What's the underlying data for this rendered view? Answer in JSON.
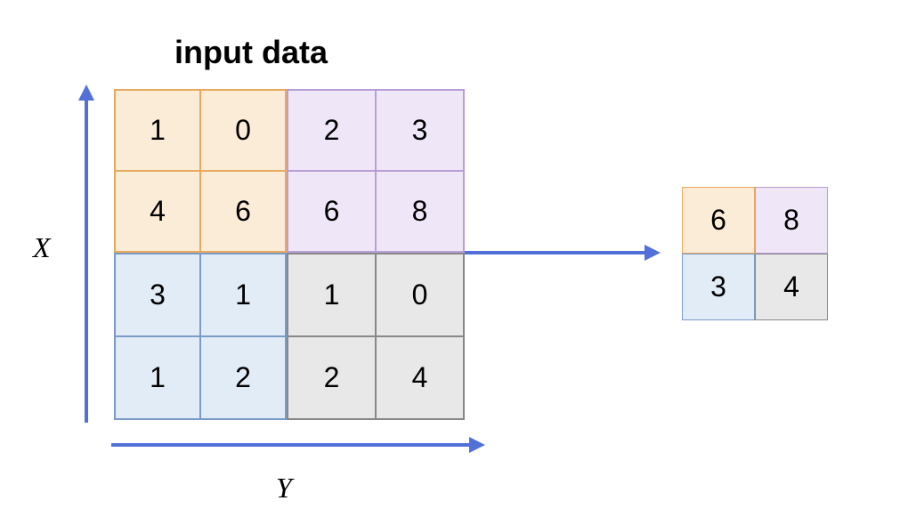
{
  "title": "input data",
  "axis": {
    "x_label": "X",
    "y_label": "Y"
  },
  "chart_data": {
    "type": "table",
    "title": "input data",
    "description": "Max pooling 2x2 applied to 4x4 input matrix producing 2x2 output",
    "input_matrix": [
      [
        1,
        0,
        2,
        3
      ],
      [
        4,
        6,
        6,
        8
      ],
      [
        3,
        1,
        1,
        0
      ],
      [
        1,
        2,
        2,
        4
      ]
    ],
    "output_matrix": [
      [
        6,
        8
      ],
      [
        3,
        4
      ]
    ],
    "quadrants": {
      "top_left": {
        "values": [
          [
            1,
            0
          ],
          [
            4,
            6
          ]
        ],
        "max": 6,
        "color": "#fbecd7"
      },
      "top_right": {
        "values": [
          [
            2,
            3
          ],
          [
            6,
            8
          ]
        ],
        "max": 8,
        "color": "#efe7f8"
      },
      "bottom_left": {
        "values": [
          [
            3,
            1
          ],
          [
            1,
            2
          ]
        ],
        "max": 3,
        "color": "#e2ecf7"
      },
      "bottom_right": {
        "values": [
          [
            1,
            0
          ],
          [
            2,
            4
          ]
        ],
        "max": 4,
        "color": "#e8e8e8"
      }
    }
  },
  "input": {
    "tl": {
      "r0c0": "1",
      "r0c1": "0",
      "r1c0": "4",
      "r1c1": "6"
    },
    "tr": {
      "r0c0": "2",
      "r0c1": "3",
      "r1c0": "6",
      "r1c1": "8"
    },
    "bl": {
      "r0c0": "3",
      "r0c1": "1",
      "r1c0": "1",
      "r1c1": "2"
    },
    "br": {
      "r0c0": "1",
      "r0c1": "0",
      "r1c0": "2",
      "r1c1": "4"
    }
  },
  "output": {
    "tl": "6",
    "tr": "8",
    "bl": "3",
    "br": "4"
  }
}
